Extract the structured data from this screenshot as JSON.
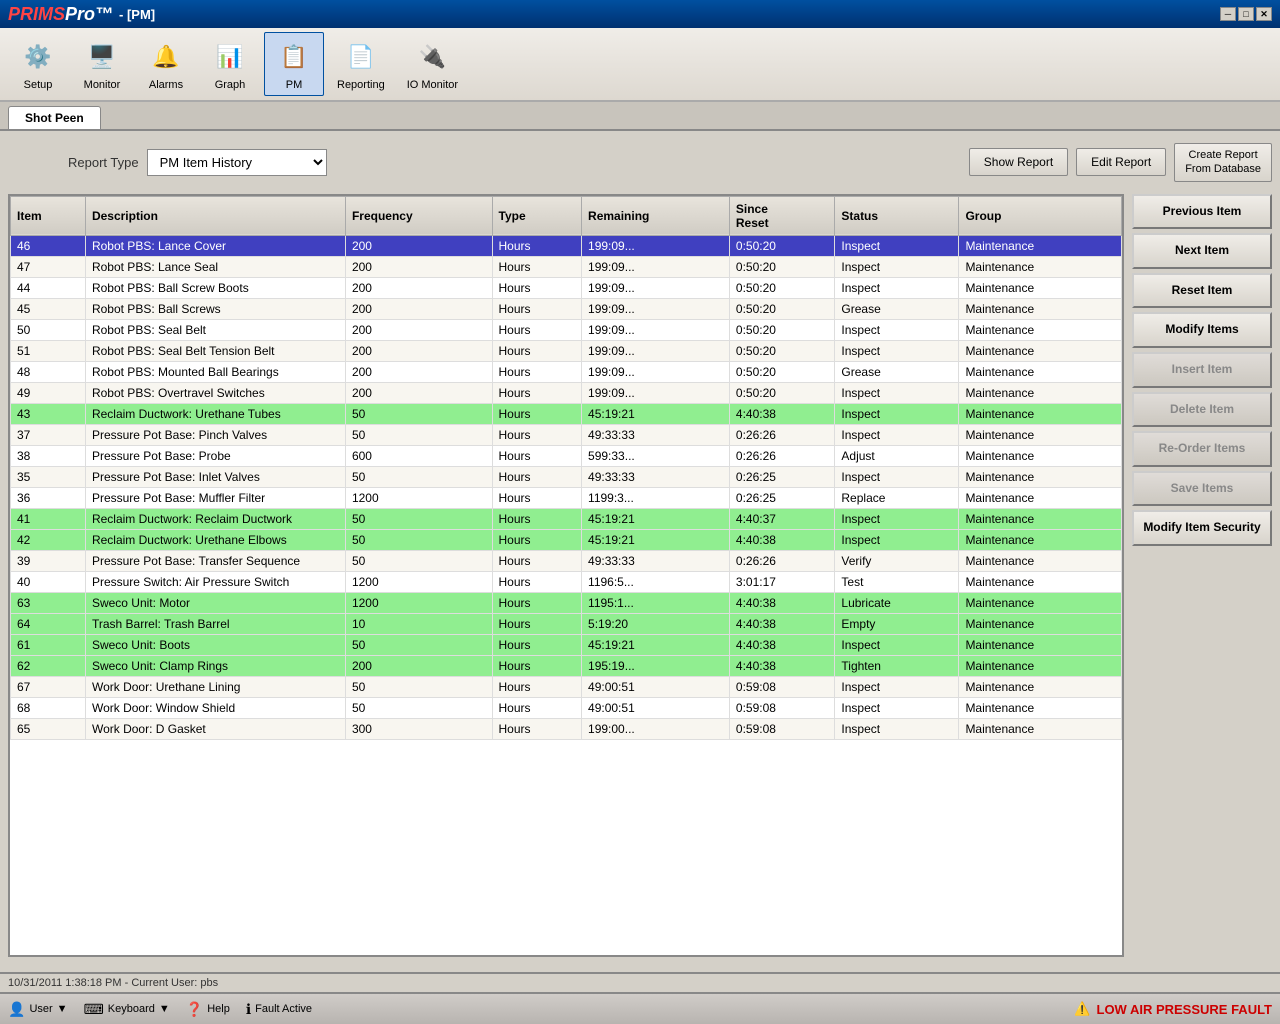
{
  "titlebar": {
    "app_name": "PRIMSPro",
    "subtitle": " - [PM]",
    "min_label": "─",
    "max_label": "□",
    "close_label": "✕"
  },
  "toolbar": {
    "items": [
      {
        "id": "setup",
        "label": "Setup",
        "icon": "⚙"
      },
      {
        "id": "monitor",
        "label": "Monitor",
        "icon": "🖥"
      },
      {
        "id": "alarms",
        "label": "Alarms",
        "icon": "🔔"
      },
      {
        "id": "graph",
        "label": "Graph",
        "icon": "📊"
      },
      {
        "id": "pm",
        "label": "PM",
        "icon": "📋"
      },
      {
        "id": "reporting",
        "label": "Reporting",
        "icon": "📄"
      },
      {
        "id": "io_monitor",
        "label": "IO Monitor",
        "icon": "🔌"
      }
    ]
  },
  "tab": {
    "label": "Shot Peen"
  },
  "reportbar": {
    "report_type_label": "Report Type",
    "report_type_value": "PM Item History",
    "show_report_label": "Show Report",
    "edit_report_label": "Edit Report",
    "create_report_label": "Create Report\nFrom Database"
  },
  "table": {
    "columns": [
      "Item",
      "Description",
      "Frequency",
      "Type",
      "Remaining",
      "Since Reset",
      "Status",
      "Group"
    ],
    "rows": [
      {
        "item": "46",
        "description": "Robot PBS: Lance Cover",
        "frequency": "200",
        "type": "Hours",
        "remaining": "199:09...",
        "since_reset": "0:50:20",
        "status": "Inspect",
        "group": "Maintenance",
        "selected": true,
        "green": false
      },
      {
        "item": "47",
        "description": "Robot PBS: Lance Seal",
        "frequency": "200",
        "type": "Hours",
        "remaining": "199:09...",
        "since_reset": "0:50:20",
        "status": "Inspect",
        "group": "Maintenance",
        "selected": false,
        "green": false
      },
      {
        "item": "44",
        "description": "Robot PBS: Ball Screw Boots",
        "frequency": "200",
        "type": "Hours",
        "remaining": "199:09...",
        "since_reset": "0:50:20",
        "status": "Inspect",
        "group": "Maintenance",
        "selected": false,
        "green": false
      },
      {
        "item": "45",
        "description": "Robot PBS: Ball Screws",
        "frequency": "200",
        "type": "Hours",
        "remaining": "199:09...",
        "since_reset": "0:50:20",
        "status": "Grease",
        "group": "Maintenance",
        "selected": false,
        "green": false
      },
      {
        "item": "50",
        "description": "Robot PBS: Seal Belt",
        "frequency": "200",
        "type": "Hours",
        "remaining": "199:09...",
        "since_reset": "0:50:20",
        "status": "Inspect",
        "group": "Maintenance",
        "selected": false,
        "green": false
      },
      {
        "item": "51",
        "description": "Robot PBS: Seal Belt Tension Belt",
        "frequency": "200",
        "type": "Hours",
        "remaining": "199:09...",
        "since_reset": "0:50:20",
        "status": "Inspect",
        "group": "Maintenance",
        "selected": false,
        "green": false
      },
      {
        "item": "48",
        "description": "Robot PBS: Mounted Ball Bearings",
        "frequency": "200",
        "type": "Hours",
        "remaining": "199:09...",
        "since_reset": "0:50:20",
        "status": "Grease",
        "group": "Maintenance",
        "selected": false,
        "green": false
      },
      {
        "item": "49",
        "description": "Robot PBS: Overtravel Switches",
        "frequency": "200",
        "type": "Hours",
        "remaining": "199:09...",
        "since_reset": "0:50:20",
        "status": "Inspect",
        "group": "Maintenance",
        "selected": false,
        "green": false
      },
      {
        "item": "43",
        "description": "Reclaim Ductwork: Urethane Tubes",
        "frequency": "50",
        "type": "Hours",
        "remaining": "45:19:21",
        "since_reset": "4:40:38",
        "status": "Inspect",
        "group": "Maintenance",
        "selected": false,
        "green": true
      },
      {
        "item": "37",
        "description": "Pressure Pot Base: Pinch Valves",
        "frequency": "50",
        "type": "Hours",
        "remaining": "49:33:33",
        "since_reset": "0:26:26",
        "status": "Inspect",
        "group": "Maintenance",
        "selected": false,
        "green": false
      },
      {
        "item": "38",
        "description": "Pressure Pot Base: Probe",
        "frequency": "600",
        "type": "Hours",
        "remaining": "599:33...",
        "since_reset": "0:26:26",
        "status": "Adjust",
        "group": "Maintenance",
        "selected": false,
        "green": false
      },
      {
        "item": "35",
        "description": "Pressure Pot Base: Inlet Valves",
        "frequency": "50",
        "type": "Hours",
        "remaining": "49:33:33",
        "since_reset": "0:26:25",
        "status": "Inspect",
        "group": "Maintenance",
        "selected": false,
        "green": false
      },
      {
        "item": "36",
        "description": "Pressure Pot Base: Muffler Filter",
        "frequency": "1200",
        "type": "Hours",
        "remaining": "1199:3...",
        "since_reset": "0:26:25",
        "status": "Replace",
        "group": "Maintenance",
        "selected": false,
        "green": false
      },
      {
        "item": "41",
        "description": "Reclaim Ductwork: Reclaim Ductwork",
        "frequency": "50",
        "type": "Hours",
        "remaining": "45:19:21",
        "since_reset": "4:40:37",
        "status": "Inspect",
        "group": "Maintenance",
        "selected": false,
        "green": true
      },
      {
        "item": "42",
        "description": "Reclaim Ductwork: Urethane Elbows",
        "frequency": "50",
        "type": "Hours",
        "remaining": "45:19:21",
        "since_reset": "4:40:38",
        "status": "Inspect",
        "group": "Maintenance",
        "selected": false,
        "green": true
      },
      {
        "item": "39",
        "description": "Pressure Pot Base: Transfer Sequence",
        "frequency": "50",
        "type": "Hours",
        "remaining": "49:33:33",
        "since_reset": "0:26:26",
        "status": "Verify",
        "group": "Maintenance",
        "selected": false,
        "green": false
      },
      {
        "item": "40",
        "description": "Pressure Switch: Air Pressure Switch",
        "frequency": "1200",
        "type": "Hours",
        "remaining": "1196:5...",
        "since_reset": "3:01:17",
        "status": "Test",
        "group": "Maintenance",
        "selected": false,
        "green": false
      },
      {
        "item": "63",
        "description": "Sweco Unit: Motor",
        "frequency": "1200",
        "type": "Hours",
        "remaining": "1195:1...",
        "since_reset": "4:40:38",
        "status": "Lubricate",
        "group": "Maintenance",
        "selected": false,
        "green": true
      },
      {
        "item": "64",
        "description": "Trash Barrel: Trash Barrel",
        "frequency": "10",
        "type": "Hours",
        "remaining": "5:19:20",
        "since_reset": "4:40:38",
        "status": "Empty",
        "group": "Maintenance",
        "selected": false,
        "green": true
      },
      {
        "item": "61",
        "description": "Sweco Unit: Boots",
        "frequency": "50",
        "type": "Hours",
        "remaining": "45:19:21",
        "since_reset": "4:40:38",
        "status": "Inspect",
        "group": "Maintenance",
        "selected": false,
        "green": true
      },
      {
        "item": "62",
        "description": "Sweco Unit: Clamp Rings",
        "frequency": "200",
        "type": "Hours",
        "remaining": "195:19...",
        "since_reset": "4:40:38",
        "status": "Tighten",
        "group": "Maintenance",
        "selected": false,
        "green": true
      },
      {
        "item": "67",
        "description": "Work Door: Urethane Lining",
        "frequency": "50",
        "type": "Hours",
        "remaining": "49:00:51",
        "since_reset": "0:59:08",
        "status": "Inspect",
        "group": "Maintenance",
        "selected": false,
        "green": false
      },
      {
        "item": "68",
        "description": "Work Door: Window Shield",
        "frequency": "50",
        "type": "Hours",
        "remaining": "49:00:51",
        "since_reset": "0:59:08",
        "status": "Inspect",
        "group": "Maintenance",
        "selected": false,
        "green": false
      },
      {
        "item": "65",
        "description": "Work Door: D Gasket",
        "frequency": "300",
        "type": "Hours",
        "remaining": "199:00...",
        "since_reset": "0:59:08",
        "status": "Inspect",
        "group": "Maintenance",
        "selected": false,
        "green": false
      }
    ]
  },
  "sidebar": {
    "previous_item": "Previous Item",
    "next_item": "Next Item",
    "reset_item": "Reset Item",
    "modify_items": "Modify Items",
    "insert_item": "Insert Item",
    "delete_item": "Delete Item",
    "reorder_items": "Re-Order Items",
    "save_items": "Save Items",
    "modify_item_security": "Modify Item Security"
  },
  "statusbar": {
    "datetime": "10/31/2011 1:38:18 PM - Current User:  pbs"
  },
  "taskbar": {
    "user_label": "User",
    "keyboard_label": "Keyboard",
    "help_label": "Help",
    "fault_label": "Fault Active",
    "fault_message": "LOW AIR PRESSURE FAULT"
  }
}
